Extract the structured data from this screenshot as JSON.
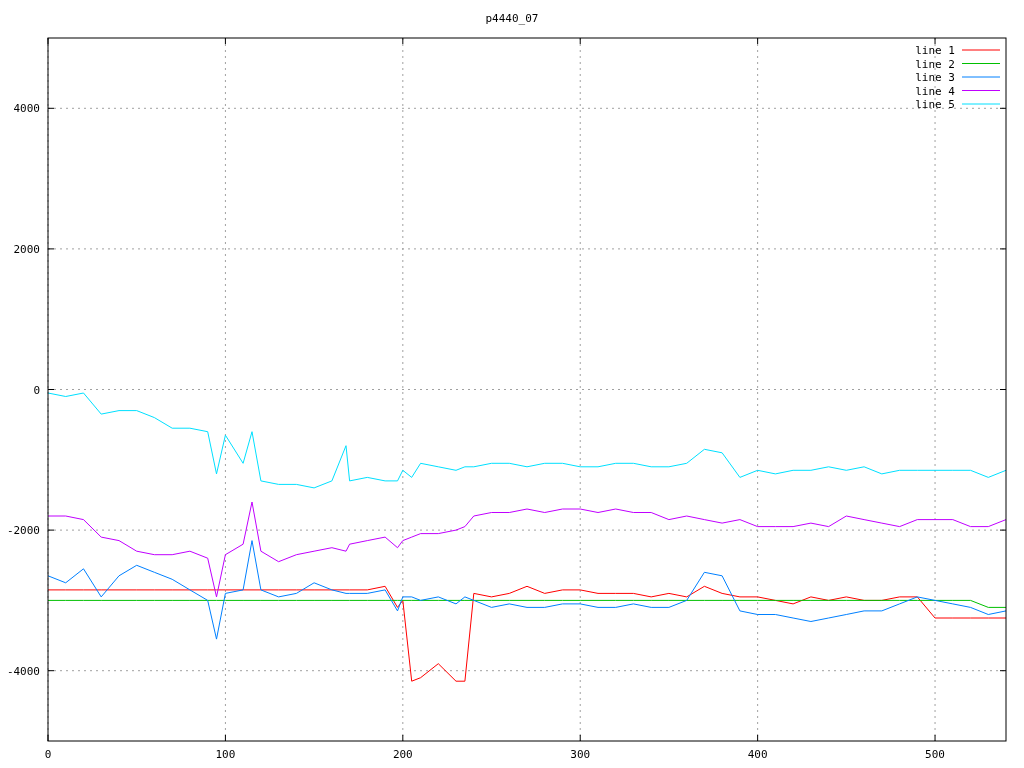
{
  "chart_data": {
    "type": "line",
    "title": "p4440_07",
    "x": [
      0,
      10,
      20,
      30,
      40,
      50,
      60,
      70,
      80,
      90,
      95,
      100,
      110,
      115,
      120,
      130,
      140,
      150,
      160,
      168,
      170,
      180,
      190,
      197,
      200,
      205,
      210,
      220,
      230,
      235,
      240,
      250,
      260,
      270,
      280,
      290,
      300,
      310,
      320,
      330,
      340,
      350,
      360,
      370,
      380,
      390,
      400,
      410,
      420,
      430,
      440,
      450,
      460,
      470,
      480,
      490,
      500,
      510,
      520,
      530,
      540
    ],
    "xlim": [
      0,
      540
    ],
    "ylim": [
      -5000,
      5000
    ],
    "xticks": [
      0,
      100,
      200,
      300,
      400,
      500
    ],
    "yticks": [
      -4000,
      -2000,
      0,
      2000,
      4000
    ],
    "grid": true,
    "legend": true,
    "series": [
      {
        "name": "line 1",
        "color": "#ff0000",
        "values": [
          -2850,
          -2850,
          -2850,
          -2850,
          -2850,
          -2850,
          -2850,
          -2850,
          -2850,
          -2850,
          -2850,
          -2850,
          -2850,
          -2850,
          -2850,
          -2850,
          -2850,
          -2850,
          -2850,
          -2850,
          -2850,
          -2850,
          -2800,
          -3100,
          -3000,
          -4150,
          -4100,
          -3900,
          -4150,
          -4150,
          -2900,
          -2950,
          -2900,
          -2800,
          -2900,
          -2850,
          -2850,
          -2900,
          -2900,
          -2900,
          -2950,
          -2900,
          -2950,
          -2800,
          -2900,
          -2950,
          -2950,
          -3000,
          -3050,
          -2950,
          -3000,
          -2950,
          -3000,
          -3000,
          -2950,
          -2950,
          -3250,
          -3250,
          -3250,
          -3250,
          -3250
        ]
      },
      {
        "name": "line 2",
        "color": "#00c000",
        "values": [
          -3000,
          -3000,
          -3000,
          -3000,
          -3000,
          -3000,
          -3000,
          -3000,
          -3000,
          -3000,
          -3000,
          -3000,
          -3000,
          -3000,
          -3000,
          -3000,
          -3000,
          -3000,
          -3000,
          -3000,
          -3000,
          -3000,
          -3000,
          -3000,
          -3000,
          -3000,
          -3000,
          -3000,
          -3000,
          -3000,
          -3000,
          -3000,
          -3000,
          -3000,
          -3000,
          -3000,
          -3000,
          -3000,
          -3000,
          -3000,
          -3000,
          -3000,
          -3000,
          -3000,
          -3000,
          -3000,
          -3000,
          -3000,
          -3000,
          -3000,
          -3000,
          -3000,
          -3000,
          -3000,
          -3000,
          -3000,
          -3000,
          -3000,
          -3000,
          -3100,
          -3100
        ]
      },
      {
        "name": "line 3",
        "color": "#0080ff",
        "values": [
          -2650,
          -2750,
          -2550,
          -2950,
          -2650,
          -2500,
          -2600,
          -2700,
          -2850,
          -3000,
          -3550,
          -2900,
          -2850,
          -2150,
          -2850,
          -2950,
          -2900,
          -2750,
          -2850,
          -2900,
          -2900,
          -2900,
          -2850,
          -3150,
          -2950,
          -2950,
          -3000,
          -2950,
          -3050,
          -2950,
          -3000,
          -3100,
          -3050,
          -3100,
          -3100,
          -3050,
          -3050,
          -3100,
          -3100,
          -3050,
          -3100,
          -3100,
          -3000,
          -2600,
          -2650,
          -3150,
          -3200,
          -3200,
          -3250,
          -3300,
          -3250,
          -3200,
          -3150,
          -3150,
          -3050,
          -2950,
          -3000,
          -3050,
          -3100,
          -3200,
          -3150
        ]
      },
      {
        "name": "line 4",
        "color": "#c000ff",
        "values": [
          -1800,
          -1800,
          -1850,
          -2100,
          -2150,
          -2300,
          -2350,
          -2350,
          -2300,
          -2400,
          -2950,
          -2350,
          -2200,
          -1600,
          -2300,
          -2450,
          -2350,
          -2300,
          -2250,
          -2300,
          -2200,
          -2150,
          -2100,
          -2250,
          -2150,
          -2100,
          -2050,
          -2050,
          -2000,
          -1950,
          -1800,
          -1750,
          -1750,
          -1700,
          -1750,
          -1700,
          -1700,
          -1750,
          -1700,
          -1750,
          -1750,
          -1850,
          -1800,
          -1850,
          -1900,
          -1850,
          -1950,
          -1950,
          -1950,
          -1900,
          -1950,
          -1800,
          -1850,
          -1900,
          -1950,
          -1850,
          -1850,
          -1850,
          -1950,
          -1950,
          -1850
        ]
      },
      {
        "name": "line 5",
        "color": "#00e0ff",
        "values": [
          -50,
          -100,
          -50,
          -350,
          -300,
          -300,
          -400,
          -550,
          -550,
          -600,
          -1200,
          -650,
          -1050,
          -600,
          -1300,
          -1350,
          -1350,
          -1400,
          -1300,
          -800,
          -1300,
          -1250,
          -1300,
          -1300,
          -1150,
          -1250,
          -1050,
          -1100,
          -1150,
          -1100,
          -1100,
          -1050,
          -1050,
          -1100,
          -1050,
          -1050,
          -1100,
          -1100,
          -1050,
          -1050,
          -1100,
          -1100,
          -1050,
          -850,
          -900,
          -1250,
          -1150,
          -1200,
          -1150,
          -1150,
          -1100,
          -1150,
          -1100,
          -1200,
          -1150,
          -1150,
          -1150,
          -1150,
          -1150,
          -1250,
          -1150
        ]
      }
    ]
  }
}
